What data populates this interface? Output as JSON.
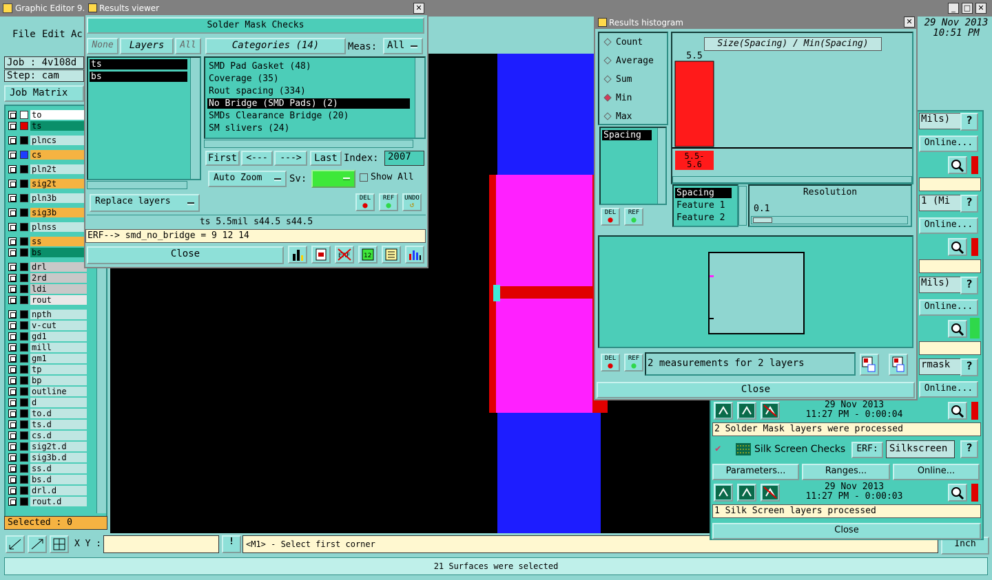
{
  "app": {
    "title": "Graphic Editor 9.0",
    "datetime": [
      "29 Nov 2013",
      "10:51 PM"
    ]
  },
  "menu": [
    "File",
    "Edit",
    "Ac"
  ],
  "job": {
    "job": "Job : 4v108d",
    "step": "Step: cam",
    "matrix_btn": "Job Matrix ..."
  },
  "layers": [
    {
      "name": "to",
      "color": "#ffffff",
      "label_bg": "#ffffff"
    },
    {
      "name": "ts",
      "color": "#e00000",
      "label_bg": "#0a8f6a"
    },
    {
      "name": "plncs",
      "color": "#000000",
      "label_bg": "#bfe6e2"
    },
    {
      "name": "cs",
      "color": "#1d3cff",
      "label_bg": "#f5b342"
    },
    {
      "name": "pln2t",
      "color": "#000000",
      "label_bg": "#bfe6e2"
    },
    {
      "name": "sig2t",
      "color": "#000000",
      "label_bg": "#f5b342"
    },
    {
      "name": "pln3b",
      "color": "#000000",
      "label_bg": "#bfe6e2"
    },
    {
      "name": "sig3b",
      "color": "#000000",
      "label_bg": "#f5b342"
    },
    {
      "name": "plnss",
      "color": "#000000",
      "label_bg": "#bfe6e2"
    },
    {
      "name": "ss",
      "color": "#000000",
      "label_bg": "#f5b342"
    },
    {
      "name": "bs",
      "color": "#000000",
      "label_bg": "#0a8f6a"
    },
    {
      "name": "drl",
      "color": "#000000",
      "label_bg": "#c8c8c8"
    },
    {
      "name": "2rd",
      "color": "#000000",
      "label_bg": "#c8c8c8"
    },
    {
      "name": "ldi",
      "color": "#000000",
      "label_bg": "#c8c8c8"
    },
    {
      "name": "rout",
      "color": "#000000",
      "label_bg": "#e8e8e8"
    },
    {
      "name": "npth",
      "color": "#000000",
      "label_bg": "#bfe6e2"
    },
    {
      "name": "v-cut",
      "color": "#000000",
      "label_bg": "#bfe6e2"
    },
    {
      "name": "gd1",
      "color": "#000000",
      "label_bg": "#bfe6e2"
    },
    {
      "name": "mill",
      "color": "#000000",
      "label_bg": "#bfe6e2"
    },
    {
      "name": "gm1",
      "color": "#000000",
      "label_bg": "#bfe6e2"
    },
    {
      "name": "tp",
      "color": "#000000",
      "label_bg": "#bfe6e2"
    },
    {
      "name": "bp",
      "color": "#000000",
      "label_bg": "#bfe6e2"
    },
    {
      "name": "outline",
      "color": "#000000",
      "label_bg": "#bfe6e2"
    },
    {
      "name": "d",
      "color": "#000000",
      "label_bg": "#bfe6e2"
    },
    {
      "name": "to.d",
      "color": "#000000",
      "label_bg": "#bfe6e2"
    },
    {
      "name": "ts.d",
      "color": "#000000",
      "label_bg": "#bfe6e2"
    },
    {
      "name": "cs.d",
      "color": "#000000",
      "label_bg": "#bfe6e2"
    },
    {
      "name": "sig2t.d",
      "color": "#000000",
      "label_bg": "#bfe6e2"
    },
    {
      "name": "sig3b.d",
      "color": "#000000",
      "label_bg": "#bfe6e2"
    },
    {
      "name": "ss.d",
      "color": "#000000",
      "label_bg": "#bfe6e2"
    },
    {
      "name": "bs.d",
      "color": "#000000",
      "label_bg": "#bfe6e2"
    },
    {
      "name": "drl.d",
      "color": "#000000",
      "label_bg": "#bfe6e2"
    },
    {
      "name": "rout.d",
      "color": "#000000",
      "label_bg": "#bfe6e2"
    }
  ],
  "selected": "Selected : 0",
  "xy_label": "X Y :",
  "prompt": "<M1> - Select first corner",
  "status": "21 Surfaces were selected",
  "results_viewer": {
    "title": "Results viewer",
    "header": "Solder Mask Checks",
    "none": "None",
    "layers": "Layers",
    "all": "All",
    "layer_list": [
      "ts",
      "bs"
    ],
    "categories_btn": "Categories (14)",
    "meas_label": "Meas:",
    "meas_value": "All",
    "categories": [
      "SMD Pad Gasket (48)",
      "Coverage (35)",
      "Rout spacing (334)",
      "No Bridge (SMD Pads) (2)",
      "SMDs Clearance Bridge (20)",
      "SM slivers (24)"
    ],
    "selected_category": 3,
    "nav": [
      "First",
      "<---",
      "--->",
      "Last"
    ],
    "index_label": "Index:",
    "index_value": "2007",
    "auto_zoom": "Auto Zoom",
    "sv_label": "Sv:",
    "show_all": "Show All",
    "replace_layers": "Replace layers",
    "icon_labels": [
      "DEL",
      "REF",
      "UNDO"
    ],
    "info": "ts 5.5mil   s44.5   s44.5",
    "erf": "ERF--> smd_no_bridge = 9 12 14",
    "close": "Close"
  },
  "histogram": {
    "title": "Results histogram",
    "radios": [
      "Count",
      "Average",
      "Sum",
      "Min",
      "Max"
    ],
    "selected_radio": 3,
    "list_item": "Spacing",
    "chart_title": "Size(Spacing) / Min(Spacing)",
    "bar_value": "5.5",
    "bin_label": "5.5- 5.6",
    "columns": [
      "Spacing",
      "Feature 1",
      "Feature 2"
    ],
    "resolution_label": "Resolution",
    "resolution_value": "0.1",
    "icon_labels": [
      "DEL",
      "REF"
    ],
    "summary": "2 measurements for 2 layers",
    "close": "Close",
    "chart_data": {
      "type": "bar",
      "categories": [
        "5.5-5.6"
      ],
      "values": [
        2
      ],
      "value_labels": [
        "5.5"
      ]
    }
  },
  "right_panel": {
    "rows": [
      {
        "text": "Mils)",
        "online": "Online..."
      },
      {
        "text": "1 (Mi",
        "online": "Online..."
      },
      {
        "text": "Mils)",
        "online": "Online..."
      },
      {
        "text": "rmask",
        "online": "Online..."
      }
    ],
    "ts1_date": "29 Nov 2013",
    "ts1_time": "11:27 PM - 0:00:04",
    "msg1": "2 Solder Mask layers were processed",
    "silk_label": "Silk Screen Checks",
    "erf_label": "ERF:",
    "erf_value": "Silkscreen",
    "params_btn": "Parameters...",
    "ranges_btn": "Ranges...",
    "online_btn": "Online...",
    "ts2_date": "29 Nov 2013",
    "ts2_time": "11:27 PM - 0:00:03",
    "msg2": "1 Silk Screen layers processed",
    "close": "Close",
    "inch": "Inch",
    "help": "?"
  }
}
